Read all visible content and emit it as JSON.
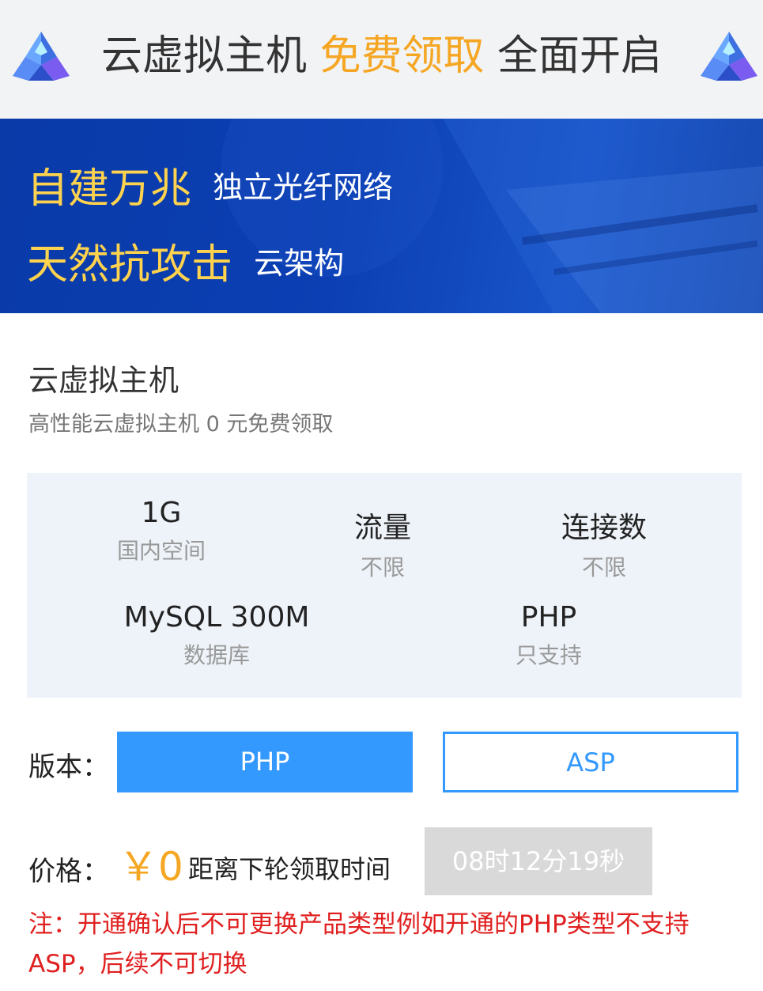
{
  "header": {
    "title_part1": "云虚拟主机",
    "title_accent": "免费领取",
    "title_part2": "全面开启",
    "logo_icon": "pyramid-logo-icon",
    "accent_color": "#f5a623"
  },
  "banner": {
    "line1_highlight": "自建万兆",
    "line1_text": "独立光纤网络",
    "line2_highlight": "天然抗攻击",
    "line2_text": "云架构",
    "highlight_color": "#ffd34d",
    "background_color": "#0b3fb3"
  },
  "product": {
    "title": "云虚拟主机",
    "subtitle": "高性能云虚拟主机 0 元免费领取"
  },
  "specs": [
    {
      "value": "1G",
      "label": "国内空间"
    },
    {
      "value": "流量",
      "label": "不限"
    },
    {
      "value": "连接数",
      "label": "不限"
    },
    {
      "value": "MySQL 300M",
      "label": "数据库"
    },
    {
      "value": "PHP",
      "label": "只支持"
    }
  ],
  "version": {
    "label": "版本：",
    "options": [
      "PHP",
      "ASP"
    ],
    "selected": "PHP",
    "selected_color": "#3399ff"
  },
  "price": {
    "label": "价格：",
    "value": "￥0",
    "countdown_label": "距离下轮领取时间",
    "countdown": "08时12分19秒"
  },
  "note": "注：开通确认后不可更换产品类型例如开通的PHP类型不支持ASP，后续不可切换",
  "note_color": "#e02020"
}
